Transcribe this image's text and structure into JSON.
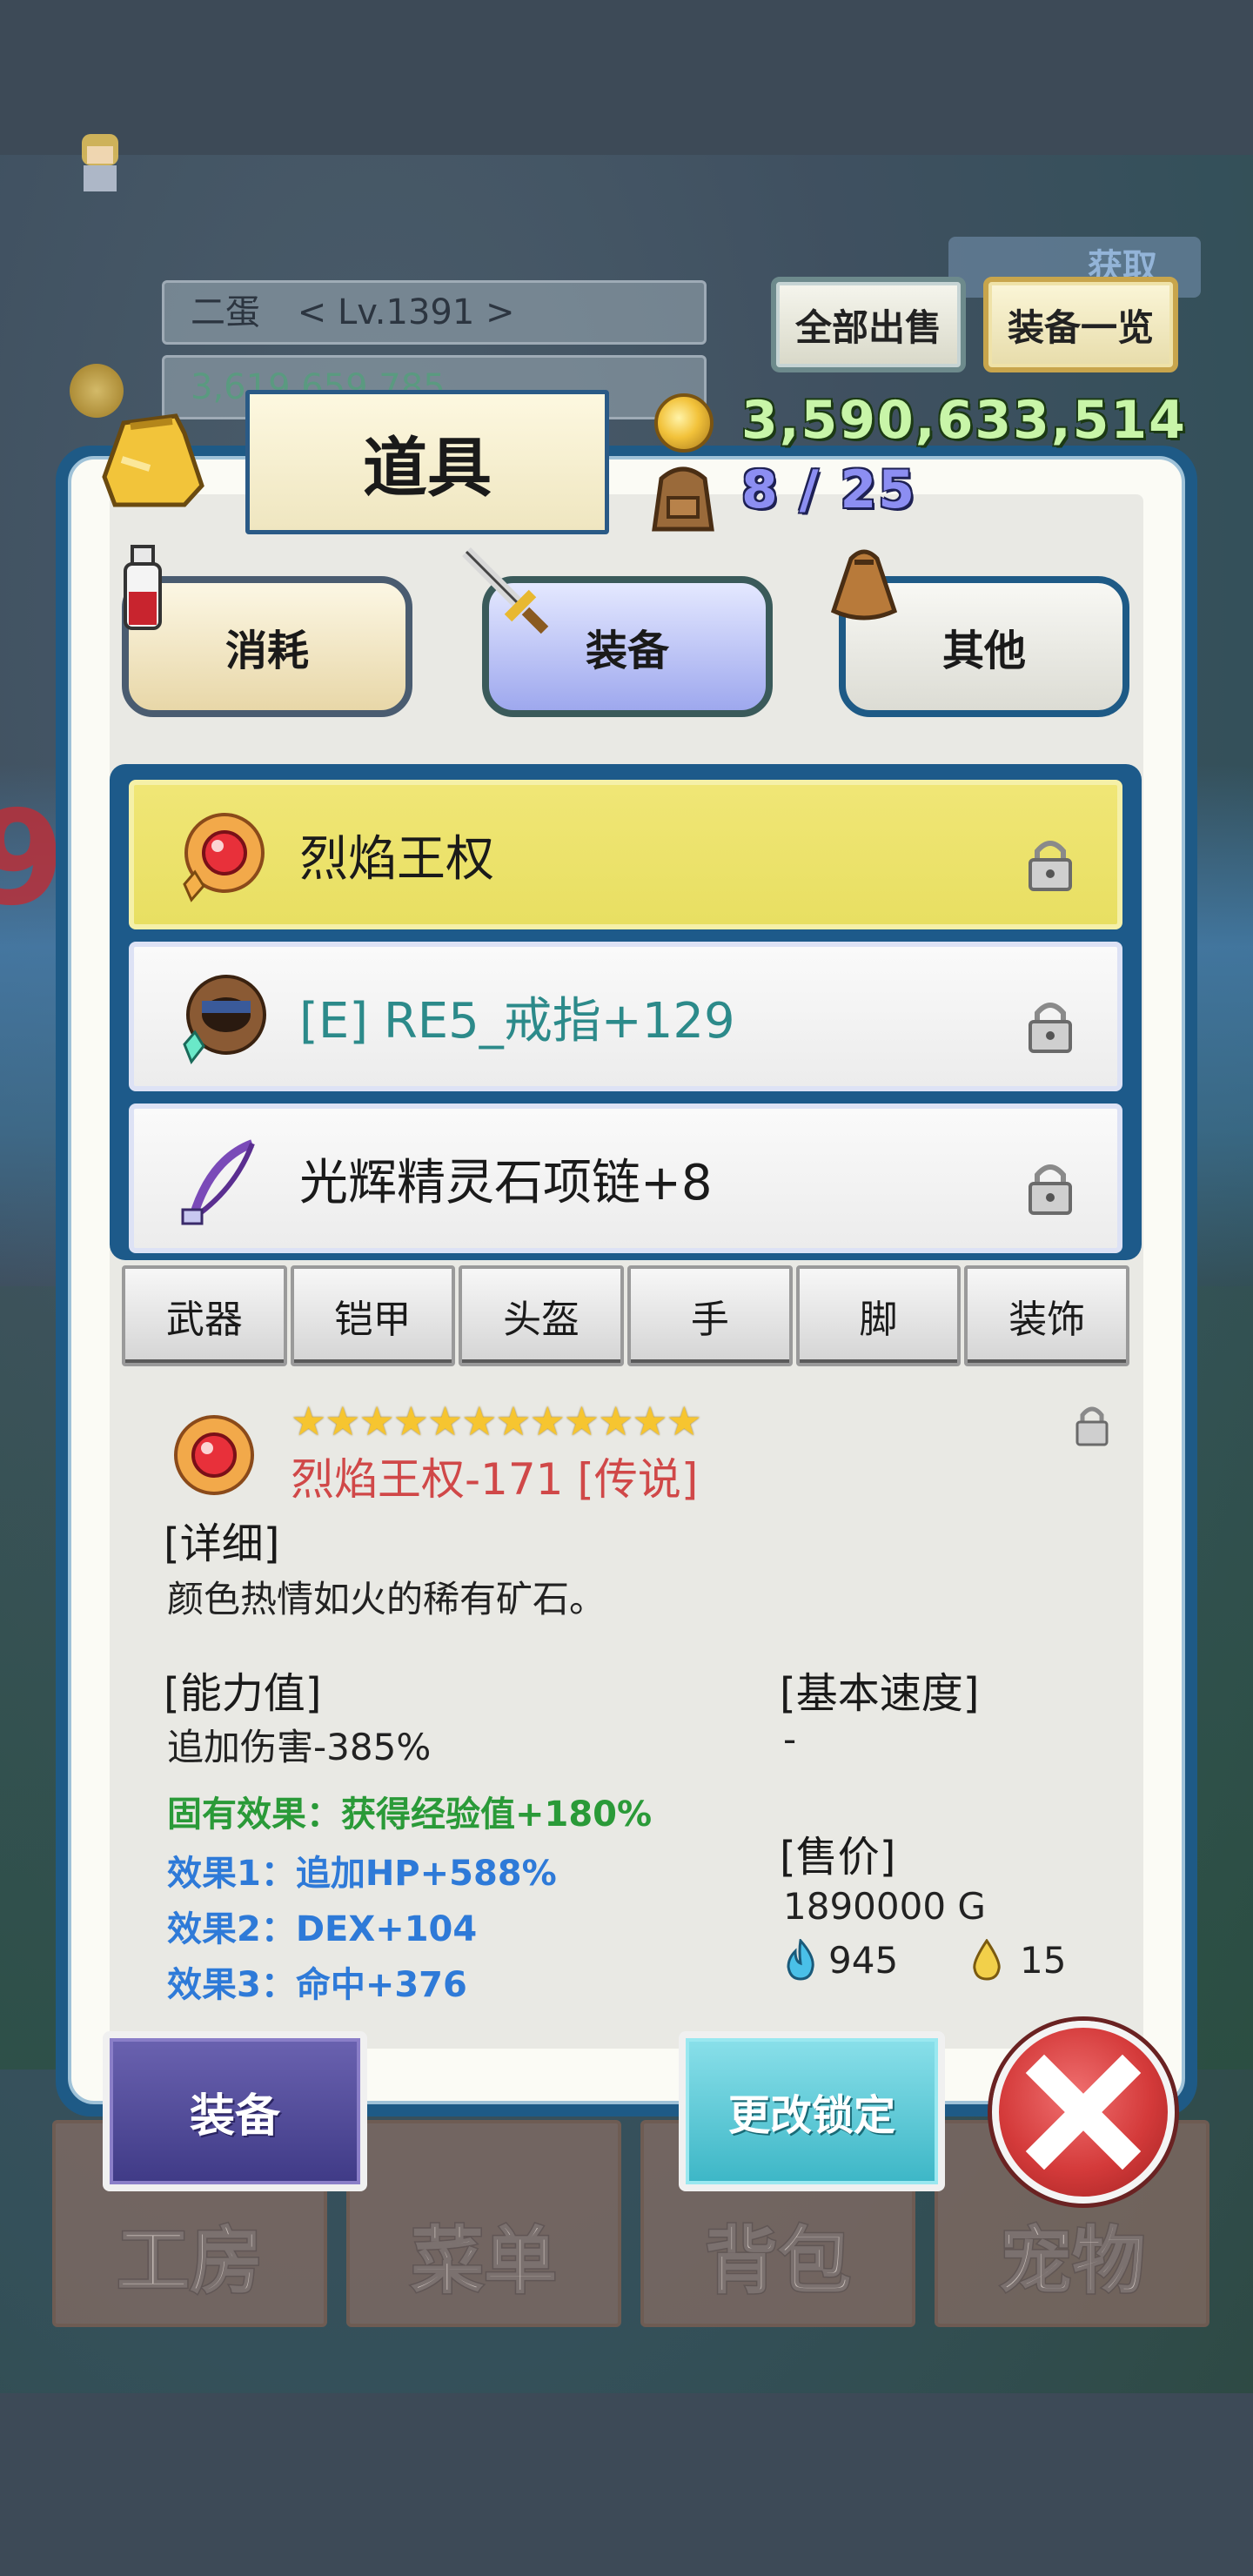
{
  "hud": {
    "player_name": "二蛋",
    "player_level": "< Lv.1391 >",
    "gold_partial": "3,619,659,785",
    "sell_all_label": "全部出售",
    "equip_list_label": "装备一览",
    "acquire_badge": "获取"
  },
  "panel": {
    "title": "道具",
    "gold": "3,590,633,514",
    "capacity": "8 / 25"
  },
  "categories": [
    {
      "label": "消耗",
      "selected": false
    },
    {
      "label": "装备",
      "selected": true
    },
    {
      "label": "其他",
      "selected": false
    }
  ],
  "items": [
    {
      "label": "烈焰王权",
      "icon": "flame-scepter-icon",
      "selected": true,
      "equipped": false
    },
    {
      "label": "[E] RE5_戒指+129",
      "icon": "ring-icon",
      "selected": false,
      "equipped": true
    },
    {
      "label": "光辉精灵石项链+8",
      "icon": "necklace-icon",
      "selected": false,
      "equipped": false
    }
  ],
  "subtabs": [
    "武器",
    "铠甲",
    "头盔",
    "手",
    "脚",
    "装饰"
  ],
  "detail": {
    "stars": "★★★★★★★★★★★★",
    "star_count": 12,
    "name": "烈焰王权-171 [传说]",
    "detail_header": "[详细]",
    "description": "颜色热情如火的稀有矿石。",
    "ability_header": "[能力值]",
    "ability_value": "追加伤害-385%",
    "fixed_effect": "固有效果：获得经验值+180%",
    "effect1": "效果1：追加HP+588%",
    "effect2": "效果2：DEX+104",
    "effect3": "效果3：命中+376",
    "speed_header": "[基本速度]",
    "speed_value": "-",
    "price_header": "[售价]",
    "price_value": "1890000 G",
    "blue_gem_count": "945",
    "gold_drop_count": "15"
  },
  "actions": {
    "equip_label": "装备",
    "change_lock_label": "更改锁定"
  },
  "bottom_nav": [
    "工房",
    "菜单",
    "背包",
    "宠物"
  ],
  "colors": {
    "panel_border": "#1e5a86",
    "selected_item": "#f0e676",
    "legend_red": "#d04848",
    "effect_green": "#2a9a38",
    "effect_blue": "#2e7ad8",
    "gold_text": "#c8f5a8",
    "capacity_text": "#8c8ef2"
  }
}
